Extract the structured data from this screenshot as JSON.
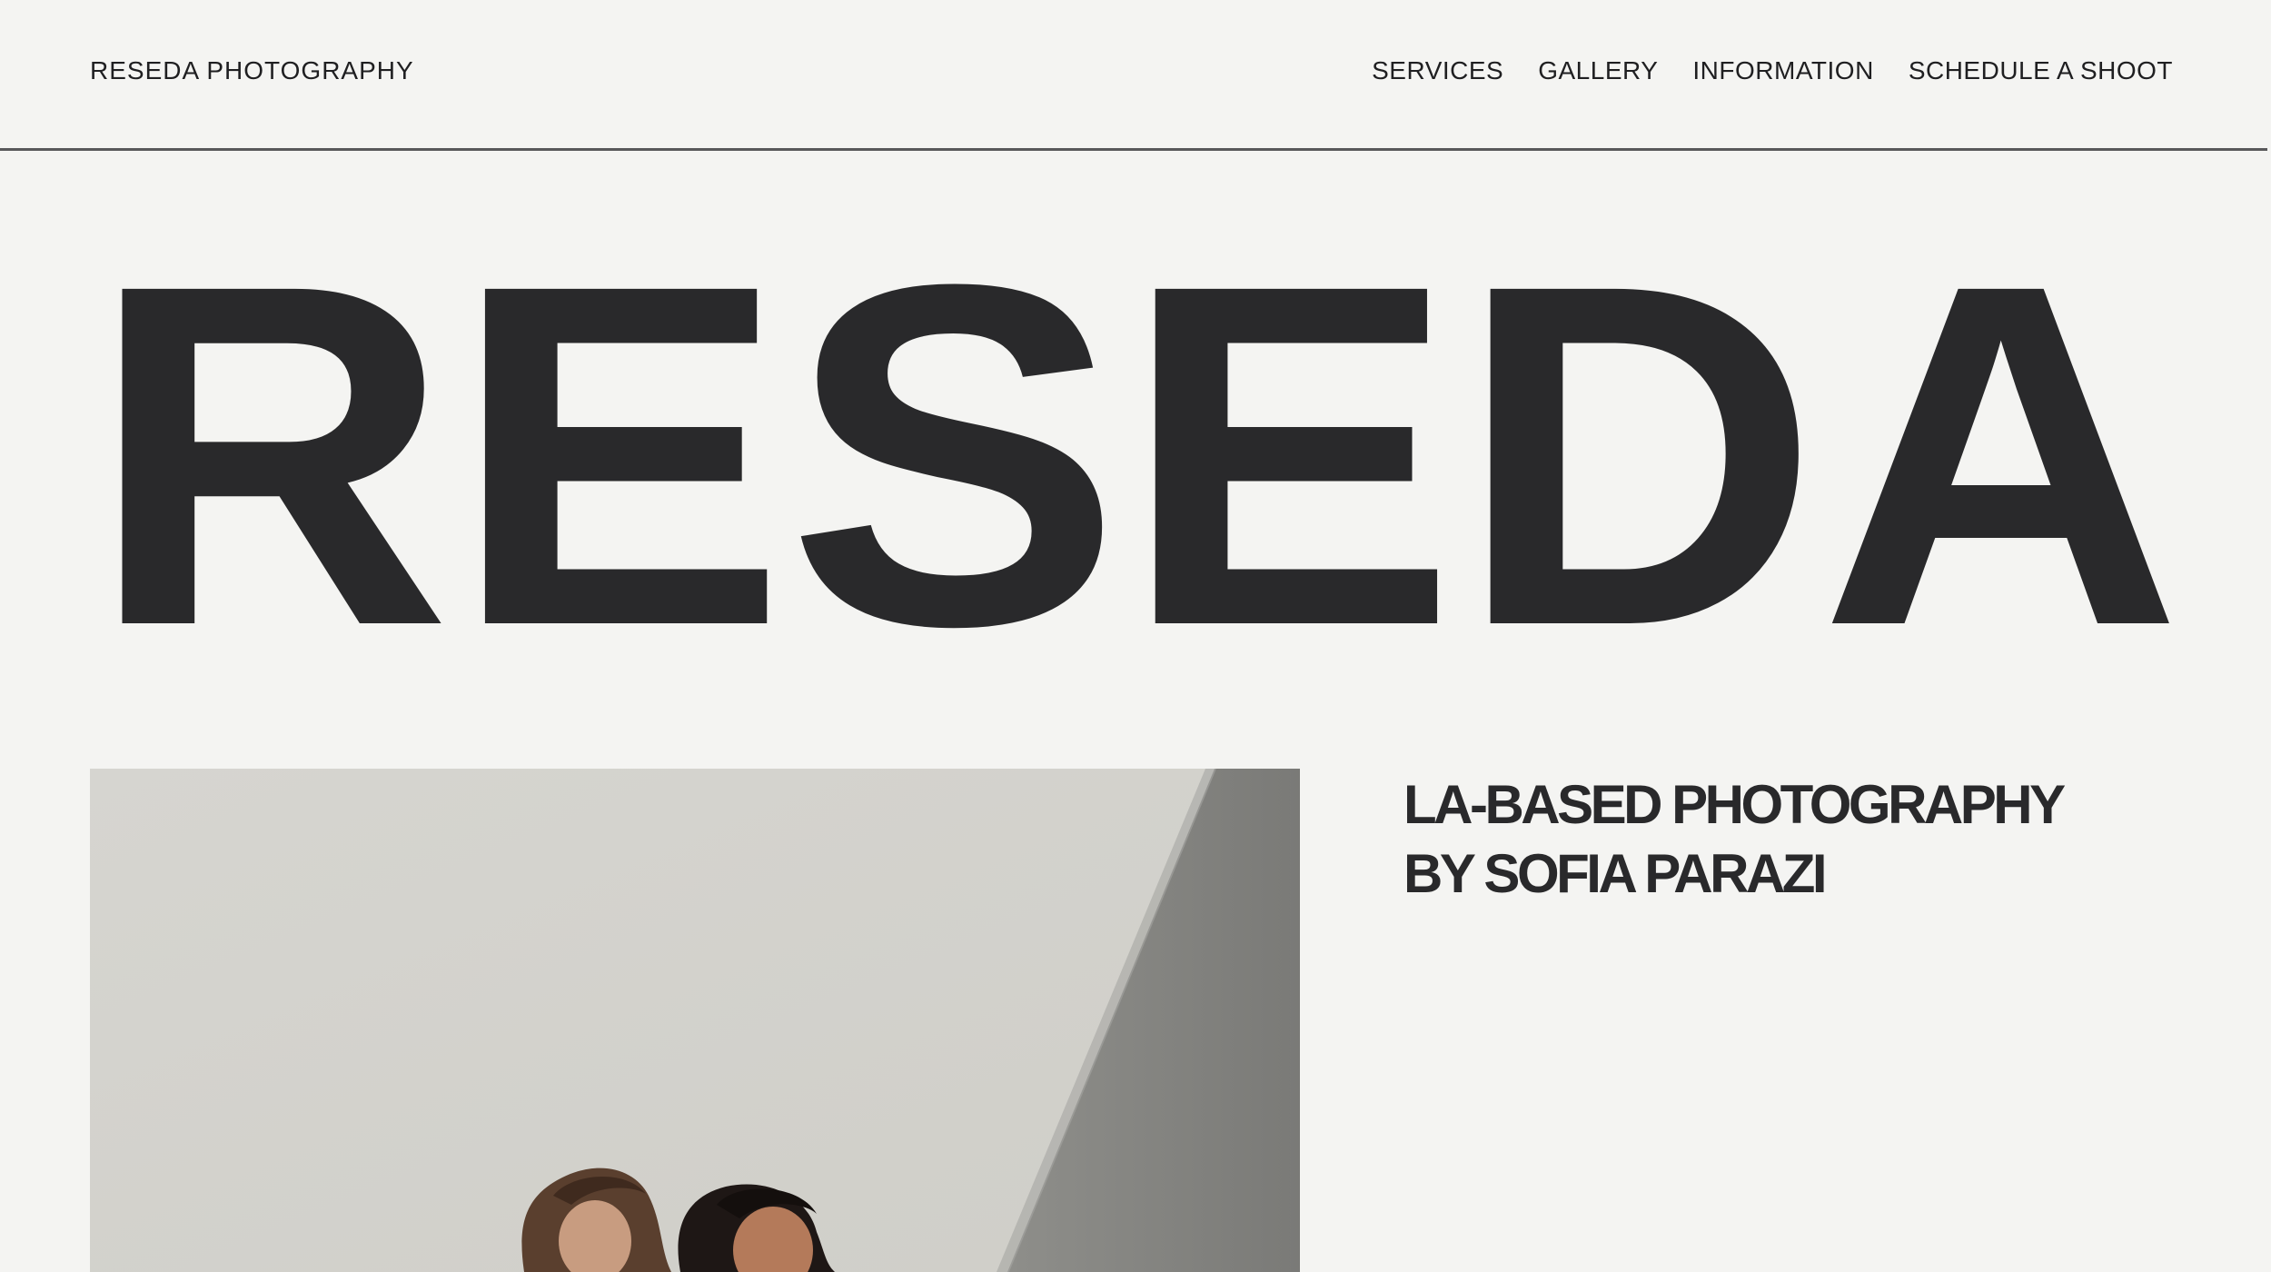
{
  "header": {
    "brand": "RESEDA PHOTOGRAPHY",
    "nav": [
      {
        "label": "SERVICES"
      },
      {
        "label": "GALLERY"
      },
      {
        "label": "INFORMATION"
      },
      {
        "label": "SCHEDULE A SHOOT"
      }
    ]
  },
  "hero": {
    "wordmark": "RESEDA"
  },
  "intro": {
    "tagline_line1": "LA-BASED PHOTOGRAPHY",
    "tagline_line2": "BY SOFIA PARAZI"
  },
  "colors": {
    "background": "#f4f4f2",
    "ink": "#29292b",
    "divider": "#58585a"
  }
}
